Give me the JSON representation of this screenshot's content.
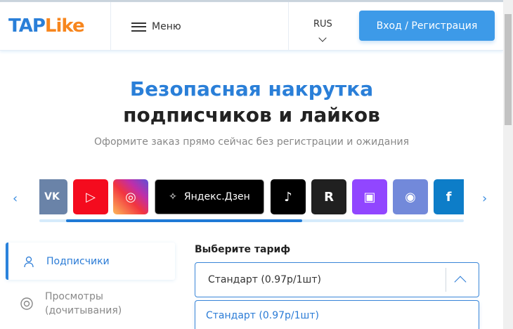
{
  "header": {
    "logo_tap": "TAP",
    "logo_like": "Like",
    "menu_label": "Меню",
    "lang": "RUS",
    "login_label": "Вход / Регистрация"
  },
  "hero": {
    "title_line1": "Безопасная накрутка",
    "title_line2": "подписчиков и лайков",
    "subtitle": "Оформите заказ прямо сейчас без регистрации и ожидания"
  },
  "platforms": {
    "items": [
      {
        "name": "vk",
        "glyph": "VK"
      },
      {
        "name": "youtube",
        "glyph": "▷"
      },
      {
        "name": "instagram",
        "glyph": "◎"
      },
      {
        "name": "yandex-zen",
        "label": "Яндекс.Дзен",
        "glyph": "✧"
      },
      {
        "name": "tiktok",
        "glyph": "♪"
      },
      {
        "name": "rutube",
        "glyph": "R"
      },
      {
        "name": "twitch",
        "glyph": "▣"
      },
      {
        "name": "discord",
        "glyph": "◉"
      },
      {
        "name": "facebook",
        "glyph": "f"
      }
    ],
    "scroll_progress": 0.56
  },
  "sidebar": {
    "items": [
      {
        "label": "Подписчики",
        "icon": "users-icon",
        "active": true
      },
      {
        "label": "Просмотры (дочитывания)",
        "icon": "eye-icon"
      }
    ]
  },
  "tariff": {
    "label": "Выберите тариф",
    "selected": "Стандарт (0.97р/1шт)",
    "options": [
      "Стандарт (0.97р/1шт)"
    ]
  },
  "colors": {
    "accent": "#3d9ae8",
    "logo_blue": "#2a7fd8",
    "logo_orange": "#f7861e"
  }
}
